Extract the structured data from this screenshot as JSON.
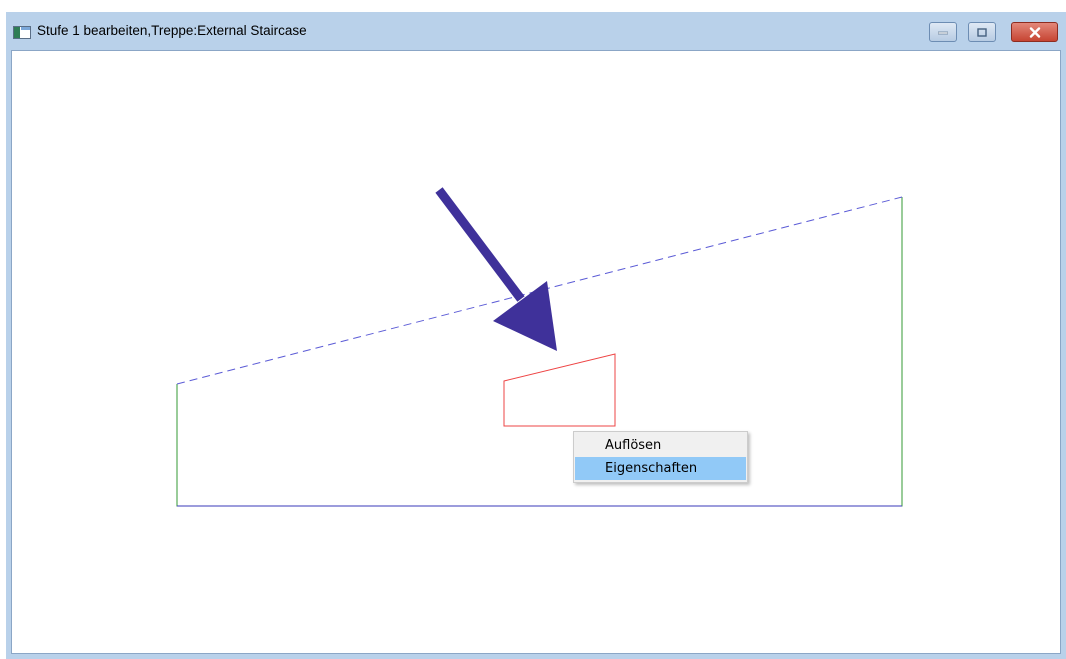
{
  "window": {
    "title": "Stufe 1 bearbeiten,Treppe:External Staircase",
    "icon": "app-window-icon",
    "controls": [
      {
        "name": "minimize",
        "icon": "minimize-icon"
      },
      {
        "name": "maximize",
        "icon": "maximize-icon"
      },
      {
        "name": "close",
        "icon": "close-icon"
      }
    ]
  },
  "context_menu": {
    "items": [
      {
        "label": "Auflösen",
        "highlighted": false
      },
      {
        "label": "Eigenschaften",
        "highlighted": true
      }
    ]
  },
  "drawing": {
    "boundary_color": "#339933",
    "slope_line_color": "#5b5bd6",
    "base_line_color": "#3a3ab8",
    "selected_shape_color": "#ee4444",
    "annotation_arrow_color": "#3f319a",
    "annotation_arrow_icon": "arrow-down-right-icon"
  },
  "colors": {
    "titlebar": "#b9d1ea",
    "menu_highlight": "#91c9f7",
    "close_button": "#c64432"
  }
}
